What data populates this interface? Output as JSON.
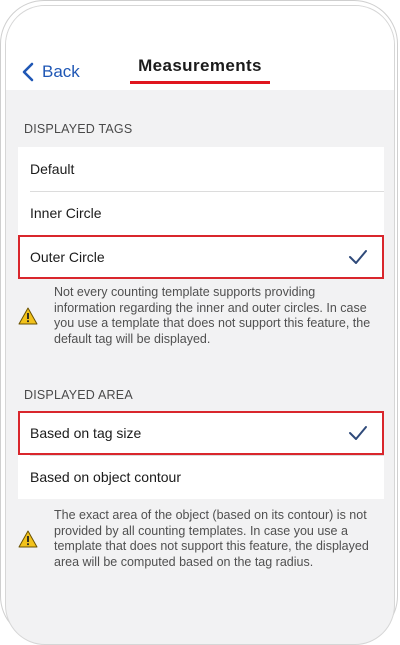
{
  "nav": {
    "back_label": "Back",
    "title": "Measurements"
  },
  "displayed_tags": {
    "header": "DISPLAYED TAGS",
    "options": [
      {
        "label": "Default",
        "selected": false
      },
      {
        "label": "Inner Circle",
        "selected": false
      },
      {
        "label": "Outer Circle",
        "selected": true
      }
    ],
    "note": "Not every counting template supports providing information regarding the inner and outer circles. In case you use a template that does not support this feature, the default tag will be displayed."
  },
  "displayed_area": {
    "header": "DISPLAYED AREA",
    "options": [
      {
        "label": "Based on tag size",
        "selected": true
      },
      {
        "label": "Based on object contour",
        "selected": false
      }
    ],
    "note": "The exact area of the object (based on its contour) is not provided by all counting templates. In case you use a template that does not support this feature, the displayed area will be computed based on the tag radius."
  },
  "colors": {
    "accent": "#1f57b5",
    "highlight": "#d9262c",
    "warning": "#f2c21b",
    "checkmark": "#2f4a7a"
  },
  "icons": {
    "back": "chevron-left-icon",
    "check": "checkmark-icon",
    "warning": "warning-icon"
  }
}
